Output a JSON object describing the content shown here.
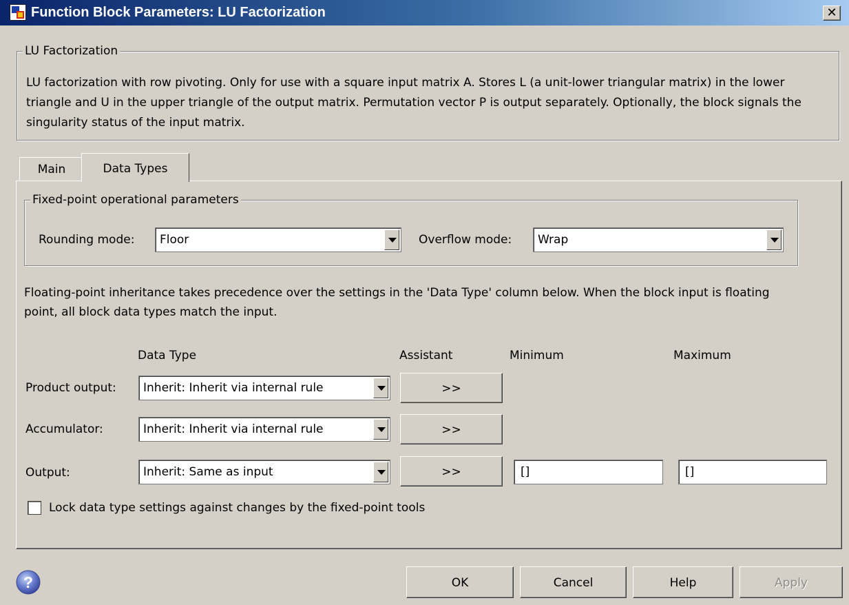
{
  "window": {
    "title": "Function Block Parameters: LU Factorization",
    "close_glyph": "✕",
    "icon": "simulink-block-icon"
  },
  "description_group": {
    "legend": "LU Factorization",
    "text": "LU factorization with row pivoting.  Only for use with a square input matrix A.  Stores L (a unit-lower triangular matrix) in the lower triangle and U in the upper triangle of the output matrix.  Permutation vector P is output separately. Optionally, the block signals the singularity status of the input matrix."
  },
  "tabs": [
    {
      "label": "Main",
      "active": false
    },
    {
      "label": "Data Types",
      "active": true
    }
  ],
  "fixed_point": {
    "legend": "Fixed-point operational parameters",
    "rounding_label": "Rounding mode:",
    "rounding_value": "Floor",
    "overflow_label": "Overflow mode:",
    "overflow_value": "Wrap"
  },
  "inheritance_note": "Floating-point inheritance takes precedence over the settings in the 'Data Type' column below. When the block input is floating point, all block data types match the input.",
  "table": {
    "headers": {
      "data_type": "Data Type",
      "assistant": "Assistant",
      "minimum": "Minimum",
      "maximum": "Maximum"
    },
    "rows": [
      {
        "label": "Product output:",
        "data_type": "Inherit: Inherit via internal rule",
        "assistant_label": ">>"
      },
      {
        "label": "Accumulator:",
        "data_type": "Inherit: Inherit via internal rule",
        "assistant_label": ">>"
      },
      {
        "label": "Output:",
        "data_type": "Inherit: Same as input",
        "assistant_label": ">>",
        "minimum": "[]",
        "maximum": "[]"
      }
    ]
  },
  "lock_checkbox": {
    "label": "Lock data type settings against changes by the fixed-point tools",
    "checked": false
  },
  "footer": {
    "ok": "OK",
    "cancel": "Cancel",
    "help": "Help",
    "apply": "Apply",
    "apply_enabled": false,
    "help_icon": "question-icon"
  },
  "colors": {
    "dialog_bg": "#d4d0c8",
    "titlebar_start": "#0a246a",
    "titlebar_end": "#a6caf0"
  }
}
